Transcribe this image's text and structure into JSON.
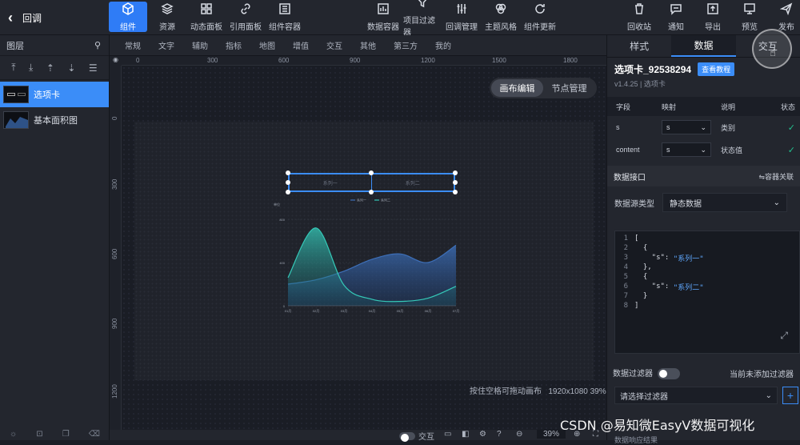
{
  "topbar": {
    "back_label": "回调",
    "left_tools": [
      {
        "label": "组件",
        "icon": "cube-icon",
        "active": true
      },
      {
        "label": "资源",
        "icon": "layers-icon"
      },
      {
        "label": "动态面板",
        "icon": "grid-icon"
      },
      {
        "label": "引用面板",
        "icon": "link-icon"
      },
      {
        "label": "组件容器",
        "icon": "container-icon"
      }
    ],
    "center_tools": [
      {
        "label": "数据容器",
        "icon": "bar-chart-icon"
      },
      {
        "label": "项目过滤器",
        "icon": "filter-icon"
      },
      {
        "label": "回调管理",
        "icon": "sliders-icon"
      },
      {
        "label": "主题风格",
        "icon": "theme-icon"
      },
      {
        "label": "组件更新",
        "icon": "refresh-icon"
      }
    ],
    "right_tools": [
      {
        "label": "回收站",
        "icon": "trash-icon"
      },
      {
        "label": "通知",
        "icon": "message-icon"
      },
      {
        "label": "导出",
        "icon": "export-icon"
      },
      {
        "label": "预览",
        "icon": "monitor-icon"
      },
      {
        "label": "发布",
        "icon": "send-icon"
      }
    ]
  },
  "layers": {
    "title": "图层",
    "items": [
      {
        "label": "选项卡",
        "selected": true
      },
      {
        "label": "基本面积图",
        "selected": false
      }
    ]
  },
  "categories": [
    "常规",
    "文字",
    "辅助",
    "指标",
    "地图",
    "增值",
    "交互",
    "其他",
    "第三方",
    "我的"
  ],
  "rulers": {
    "h": [
      "0",
      "300",
      "600",
      "900",
      "1200",
      "1500",
      "1800"
    ],
    "v": [
      "0",
      "300",
      "600",
      "900",
      "1200"
    ]
  },
  "canvas": {
    "mode_tabs": [
      "画布编辑",
      "节点管理"
    ],
    "active_mode": "画布编辑",
    "hint": "按住空格可拖动画布",
    "size_info": "1920x1080 39%",
    "zoom": "39%",
    "interaction_label": "交互",
    "widget_tabs": [
      "系列一",
      "系列二"
    ],
    "chart_legend": [
      "系列一",
      "系列二"
    ],
    "chart_ylabel": "单位",
    "chart_yticks": [
      "0",
      "400",
      "800"
    ],
    "chart_xticks": [
      "01月",
      "02月",
      "03月",
      "04月",
      "05月",
      "06月",
      "07月"
    ]
  },
  "chart_data": {
    "type": "area",
    "x": [
      "01月",
      "02月",
      "03月",
      "04月",
      "05月",
      "06月",
      "07月"
    ],
    "series": [
      {
        "name": "系列一",
        "values": [
          200,
          240,
          320,
          430,
          480,
          400,
          560
        ]
      },
      {
        "name": "系列二",
        "values": [
          260,
          720,
          190,
          60,
          40,
          70,
          180
        ]
      }
    ],
    "ylabel": "单位",
    "ylim": [
      0,
      800
    ],
    "colors": {
      "系列一": "#3d6fb8",
      "系列二": "#35c9b8"
    }
  },
  "right_panel": {
    "tabs": [
      "样式",
      "数据",
      "交互"
    ],
    "active_tab": "数据",
    "component_name": "选项卡_92538294",
    "doc_button": "查看教程",
    "version": "v1.4.25 | 选项卡",
    "field_table": {
      "headers": [
        "字段",
        "映射",
        "说明",
        "状态"
      ],
      "rows": [
        {
          "field": "s",
          "mapping": "s",
          "desc": "类别"
        },
        {
          "field": "content",
          "mapping": "s",
          "desc": "状态值"
        }
      ]
    },
    "data_api": {
      "title": "数据接口",
      "link": "⇋容器关联",
      "source_label": "数据源类型",
      "source_value": "静态数据"
    },
    "code_lines": [
      {
        "n": "1",
        "text": "["
      },
      {
        "n": "2",
        "text": "  {"
      },
      {
        "n": "3",
        "key": "    \"s\": ",
        "val": "\"系列一\""
      },
      {
        "n": "4",
        "text": "  },"
      },
      {
        "n": "5",
        "text": "  {"
      },
      {
        "n": "6",
        "key": "    \"s\": ",
        "val": "\"系列二\""
      },
      {
        "n": "7",
        "text": "  }"
      },
      {
        "n": "8",
        "text": "]"
      }
    ],
    "filter_label": "数据过滤器",
    "filter_note": "当前未添加过滤器",
    "filter_placeholder": "请选择过滤器",
    "filter_add": "+",
    "result_label": "数据响应结果"
  },
  "watermark": "CSDN @易知微EasyV数据可视化",
  "colors": {
    "accent": "#3b8df8",
    "check": "#22c08e"
  }
}
